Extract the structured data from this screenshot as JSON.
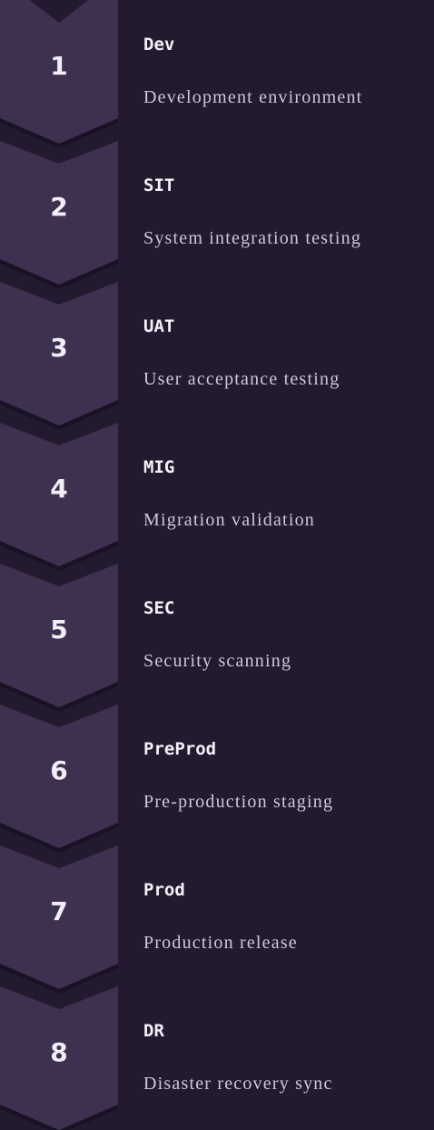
{
  "colors": {
    "background": "#241a30",
    "chevron": "#3e3150",
    "chevron_shadow": "#1a1224",
    "number": "#f2eef7",
    "title": "#f4f0f8",
    "description": "#cfc8d8"
  },
  "stages": [
    {
      "number": "1",
      "title": "Dev",
      "description": "Development environment"
    },
    {
      "number": "2",
      "title": "SIT",
      "description": "System integration testing"
    },
    {
      "number": "3",
      "title": "UAT",
      "description": "User acceptance testing"
    },
    {
      "number": "4",
      "title": "MIG",
      "description": "Migration validation"
    },
    {
      "number": "5",
      "title": "SEC",
      "description": "Security scanning"
    },
    {
      "number": "6",
      "title": "PreProd",
      "description": "Pre-production staging"
    },
    {
      "number": "7",
      "title": "Prod",
      "description": "Production release"
    },
    {
      "number": "8",
      "title": "DR",
      "description": "Disaster recovery sync"
    }
  ]
}
